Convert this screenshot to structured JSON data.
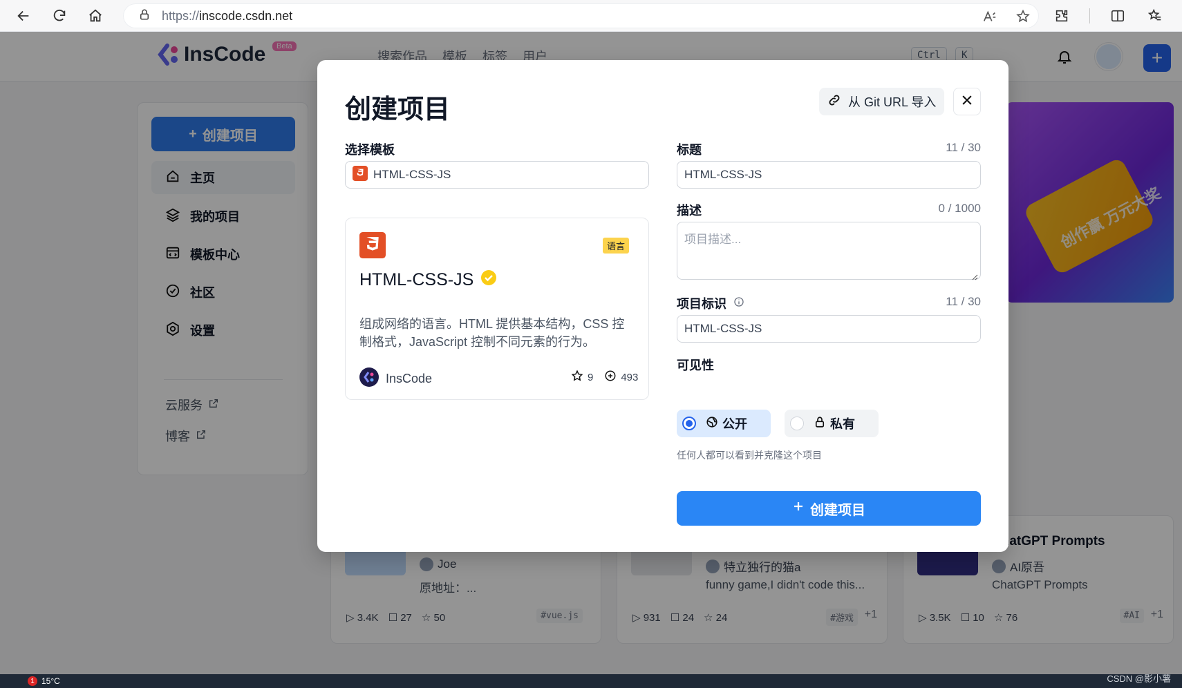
{
  "browser": {
    "url_proto": "https://",
    "url_host": "inscode.csdn.net"
  },
  "site": {
    "logo_text": "InsCode",
    "logo_badge": "Beta",
    "search_tabs": [
      "搜索作品",
      "模板",
      "标签",
      "用户"
    ],
    "kbd_ctrl": "Ctrl",
    "kbd_k": "K",
    "sidebar": {
      "create_label": "创建项目",
      "items": [
        {
          "label": "主页",
          "icon": "home-icon"
        },
        {
          "label": "我的项目",
          "icon": "layers-icon"
        },
        {
          "label": "模板中心",
          "icon": "template-icon"
        },
        {
          "label": "社区",
          "icon": "community-icon"
        },
        {
          "label": "设置",
          "icon": "settings-icon"
        }
      ],
      "links": [
        "云服务",
        "博客"
      ]
    },
    "banner_text": "创作赢 万元大奖",
    "cards": [
      {
        "title": "",
        "author": "Joe",
        "desc": "原地址：...",
        "plays": "3.4K",
        "comments": "27",
        "stars": "50",
        "tag": "#vue.js",
        "more": ""
      },
      {
        "title": "",
        "author": "特立独行的猫a",
        "desc": "funny game,I didn't code this...",
        "plays": "931",
        "comments": "24",
        "stars": "24",
        "tag": "#游戏",
        "more": "+1"
      },
      {
        "title": "ChatGPT Prompts",
        "author": "AI原吾",
        "desc": "ChatGPT Prompts",
        "plays": "3.5K",
        "comments": "10",
        "stars": "76",
        "tag": "#AI",
        "more": "+1"
      }
    ]
  },
  "modal": {
    "title": "创建项目",
    "git_import_label": "从 Git URL 导入",
    "template_label": "选择模板",
    "template_value": "HTML-CSS-JS",
    "template_card": {
      "badge": "语言",
      "name": "HTML-CSS-JS",
      "description": "组成网络的语言。HTML 提供基本结构，CSS 控制格式，JavaScript 控制不同元素的行为。",
      "author": "InsCode",
      "stars": "9",
      "forks": "493"
    },
    "title_label": "标题",
    "title_counter": "11 / 30",
    "title_value": "HTML-CSS-JS",
    "desc_label": "描述",
    "desc_counter": "0 / 1000",
    "desc_placeholder": "项目描述...",
    "id_label": "项目标识",
    "id_counter": "11 / 30",
    "id_value": "HTML-CSS-JS",
    "visibility_label": "可见性",
    "visibility_public": "公开",
    "visibility_private": "私有",
    "visibility_selected": "public",
    "visibility_hint": "任何人都可以看到并克隆这个项目",
    "submit_label": "创建项目"
  },
  "taskbar": {
    "notify_count": "1",
    "weather": "15°C"
  },
  "watermark": "CSDN @影小薯",
  "colors": {
    "primary": "#2a86f5",
    "html5": "#e34f26",
    "badge": "#fcd34d"
  }
}
